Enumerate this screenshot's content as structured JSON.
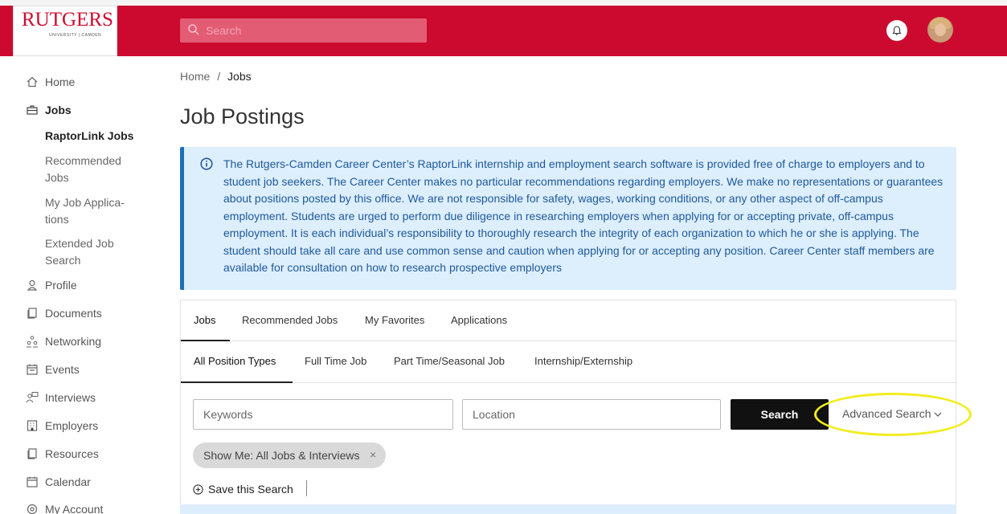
{
  "header": {
    "logo_text": "RUTGERS",
    "logo_sub": "UNIVERSITY | CAMDEN",
    "search_placeholder": "Search"
  },
  "sidebar": {
    "items": [
      {
        "label": "Home",
        "icon": "home-icon"
      },
      {
        "label": "Jobs",
        "icon": "briefcase-icon"
      },
      {
        "label": "Profile",
        "icon": "profile-icon"
      },
      {
        "label": "Documents",
        "icon": "documents-icon"
      },
      {
        "label": "Networking",
        "icon": "networking-icon"
      },
      {
        "label": "Events",
        "icon": "events-icon"
      },
      {
        "label": "Interviews",
        "icon": "interviews-icon"
      },
      {
        "label": "Employers",
        "icon": "employers-icon"
      },
      {
        "label": "Resources",
        "icon": "resources-icon"
      },
      {
        "label": "Calendar",
        "icon": "calendar-icon"
      },
      {
        "label": "My Account",
        "icon": "account-icon"
      }
    ],
    "jobs_sub": {
      "raptorlink": "RaptorLink Jobs",
      "recommended_1": "Recommended",
      "recommended_2": "Jobs",
      "applications_1": "My Job Applica-",
      "applications_2": "tions",
      "extended_1": "Extended Job",
      "extended_2": "Search"
    }
  },
  "breadcrumb": {
    "home": "Home",
    "sep": "/",
    "current": "Jobs"
  },
  "page_title": "Job Postings",
  "notice": "The Rutgers-Camden Career Center’s RaptorLink internship and employment search software is provided free of charge to employers and to student job seekers. The Career Center makes no particular recommendations regarding employers. We make no representations or guarantees about positions posted by this office. We are not responsible for safety, wages, working conditions, or any other aspect of off-campus employment. Students are urged to perform due diligence in researching employers when applying for or accepting private, off-campus employment. It is each individual’s responsibility to thoroughly research the integrity of each organization to which he or she is applying. The student should take all care and use common sense and caution when applying for or accepting any position. Career Center staff members are available for consultation on how to research prospective employers",
  "tabs": [
    "Jobs",
    "Recommended Jobs",
    "My Favorites",
    "Applications"
  ],
  "position_tabs": [
    "All Position Types",
    "Full Time Job",
    "Part Time/Seasonal Job",
    "Internship/Externship"
  ],
  "search": {
    "keywords_placeholder": "Keywords",
    "location_placeholder": "Location",
    "button": "Search",
    "advanced": "Advanced Search"
  },
  "filter_chip": {
    "label": "Show Me: All Jobs & Interviews",
    "remove": "×"
  },
  "save_search": "Save this Search",
  "colors": {
    "brand": "#cc0a2f",
    "notice_bg": "#ddeefd",
    "notice_text": "#1e5a9a",
    "highlight": "#f2ec20"
  }
}
